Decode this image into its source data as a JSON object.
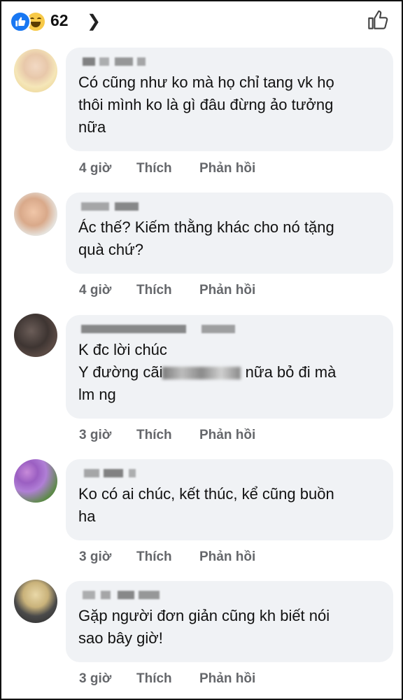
{
  "header": {
    "reaction_count": "62",
    "colors": {
      "like": "#1877f2",
      "haha": "#f7c948"
    }
  },
  "comments": [
    {
      "lines": [
        "Có cũng như ko mà họ chỉ tang vk họ",
        "thôi  mình ko là gì đâu đừng ảo tưởng",
        "nữa"
      ],
      "time": "4 giờ",
      "like": "Thích",
      "reply": "Phản hồi"
    },
    {
      "lines": [
        "Ác thế? Kiếm thằng khác cho nó tặng",
        "quà chứ?"
      ],
      "time": "4 giờ",
      "like": "Thích",
      "reply": "Phản hồi"
    },
    {
      "lines": [
        "K đc lời chúc",
        "Y đường cãi",
        "nữa bỏ đi mà",
        "lm ng"
      ],
      "time": "3 giờ",
      "like": "Thích",
      "reply": "Phản hồi"
    },
    {
      "lines": [
        "Ko có ai chúc, kết thúc, kể cũng buồn",
        "ha"
      ],
      "time": "3 giờ",
      "like": "Thích",
      "reply": "Phản hồi"
    },
    {
      "lines": [
        "Gặp người đơn giản cũng kh biết nói",
        "sao bây giờ!"
      ],
      "time": "3 giờ",
      "like": "Thích",
      "reply": "Phản hồi"
    }
  ]
}
